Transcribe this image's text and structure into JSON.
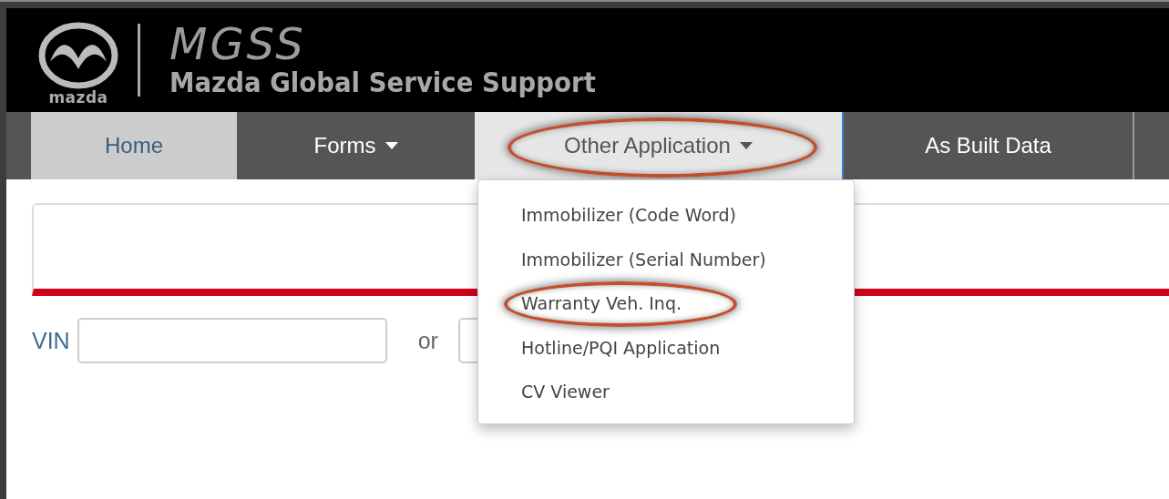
{
  "header": {
    "brand_wordmark": "mazda",
    "app_name": "MGSS",
    "app_subtitle": "Mazda Global Service Support"
  },
  "tabs": [
    {
      "label": "Home",
      "kind": "link",
      "selected": true,
      "highlighted": false
    },
    {
      "label": "Forms",
      "kind": "dropdown",
      "selected": false,
      "expanded": false,
      "highlighted": false
    },
    {
      "label": "Other Application",
      "kind": "dropdown",
      "selected": false,
      "expanded": true,
      "highlighted": true,
      "menu": [
        {
          "label": "Immobilizer (Code Word)",
          "highlighted": false
        },
        {
          "label": "Immobilizer (Serial Number)",
          "highlighted": false
        },
        {
          "label": "Warranty Veh. Inq.",
          "highlighted": true
        },
        {
          "label": "Hotline/PQI Application",
          "highlighted": false
        },
        {
          "label": "CV Viewer",
          "highlighted": false
        }
      ]
    },
    {
      "label": "As Built Data",
      "kind": "link",
      "selected": false,
      "highlighted": false
    }
  ],
  "search": {
    "vin_label": "VIN",
    "or_label": "or"
  }
}
